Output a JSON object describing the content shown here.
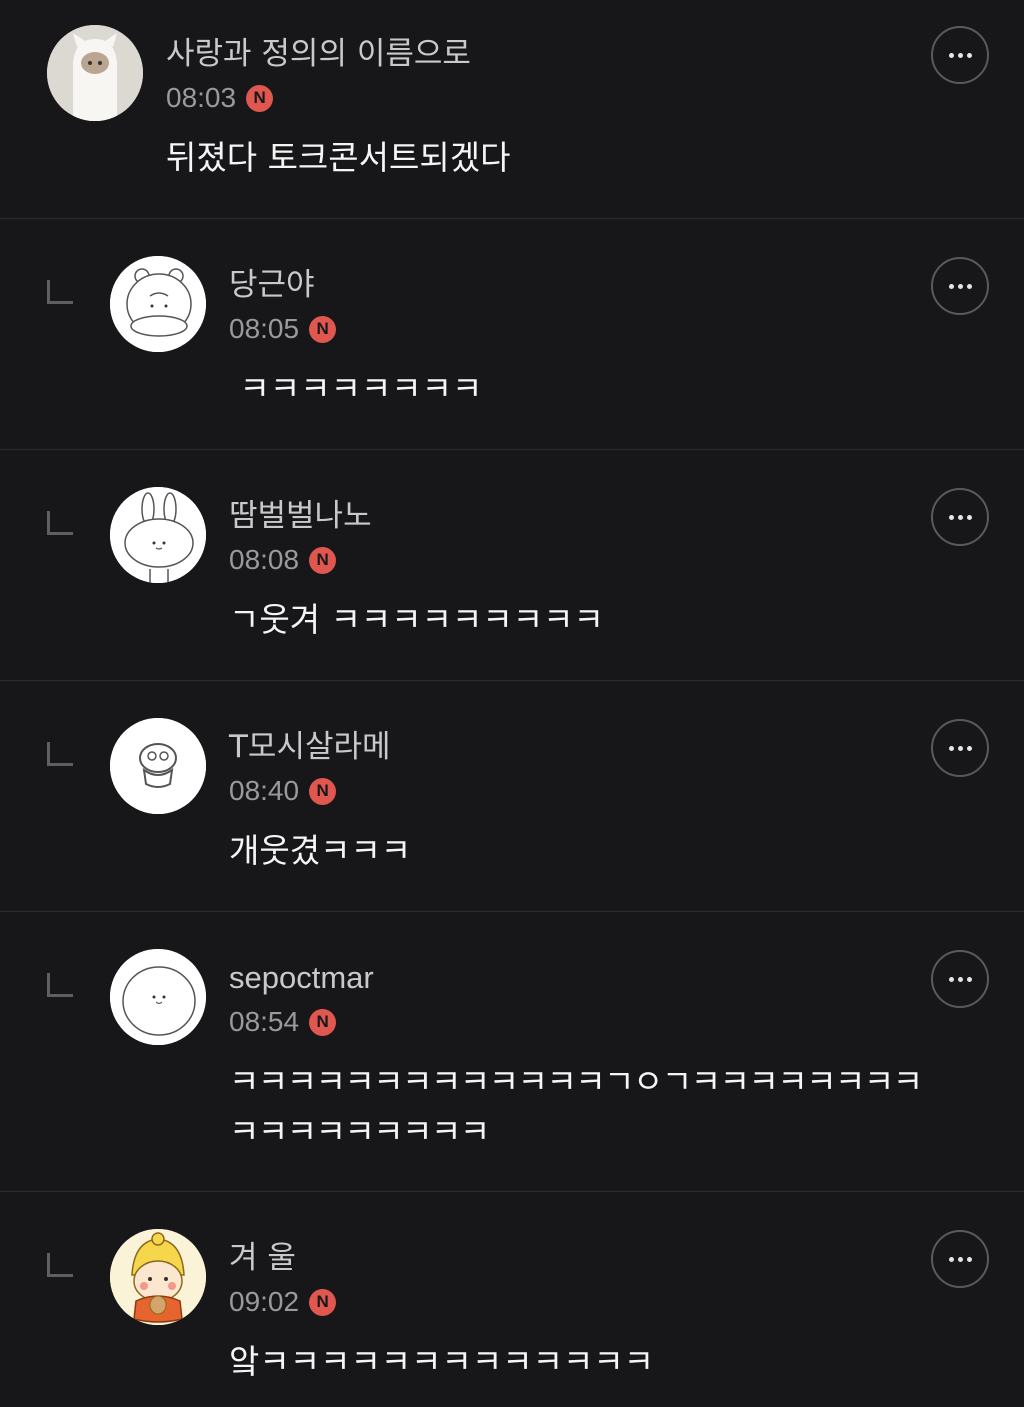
{
  "comments": [
    {
      "author": "사랑과 정의의 이름으로",
      "time": "08:03",
      "badge": "N",
      "text": "뒤졌다 토크콘서트되겠다",
      "avatar_icon": "ghost-cat-figure-icon",
      "is_reply": false
    },
    {
      "author": "당근야",
      "time": "08:05",
      "badge": "N",
      "text": " ㅋㅋㅋㅋㅋㅋㅋㅋ",
      "avatar_icon": "hamster-icon",
      "is_reply": true
    },
    {
      "author": "땀벌벌나노",
      "time": "08:08",
      "badge": "N",
      "text": "ㄱ웃겨 ㅋㅋㅋㅋㅋㅋㅋㅋㅋ",
      "avatar_icon": "bunny-icon",
      "is_reply": true
    },
    {
      "author": "T모시살라메",
      "time": "08:40",
      "badge": "N",
      "text": "개웃겼ㅋㅋㅋ",
      "avatar_icon": "small-creature-icon",
      "is_reply": true
    },
    {
      "author": "sepoctmar",
      "time": "08:54",
      "badge": "N",
      "text": "ㅋㅋㅋㅋㅋㅋㅋㅋㅋㅋㅋㅋㅋㄱㅇㄱㅋㅋㅋㅋㅋㅋㅋㅋ\nㅋㅋㅋㅋㅋㅋㅋㅋㅋ",
      "avatar_icon": "round-face-icon",
      "is_reply": true
    },
    {
      "author": "겨 울",
      "time": "09:02",
      "badge": "N",
      "text": "앜ㅋㅋㅋㅋㅋㅋㅋㅋㅋㅋㅋㅋㅋ",
      "avatar_icon": "yellow-hat-character-icon",
      "is_reply": true
    }
  ],
  "colors": {
    "background": "#17171a",
    "divider": "#2c2c30",
    "badge": "#e0574f"
  }
}
